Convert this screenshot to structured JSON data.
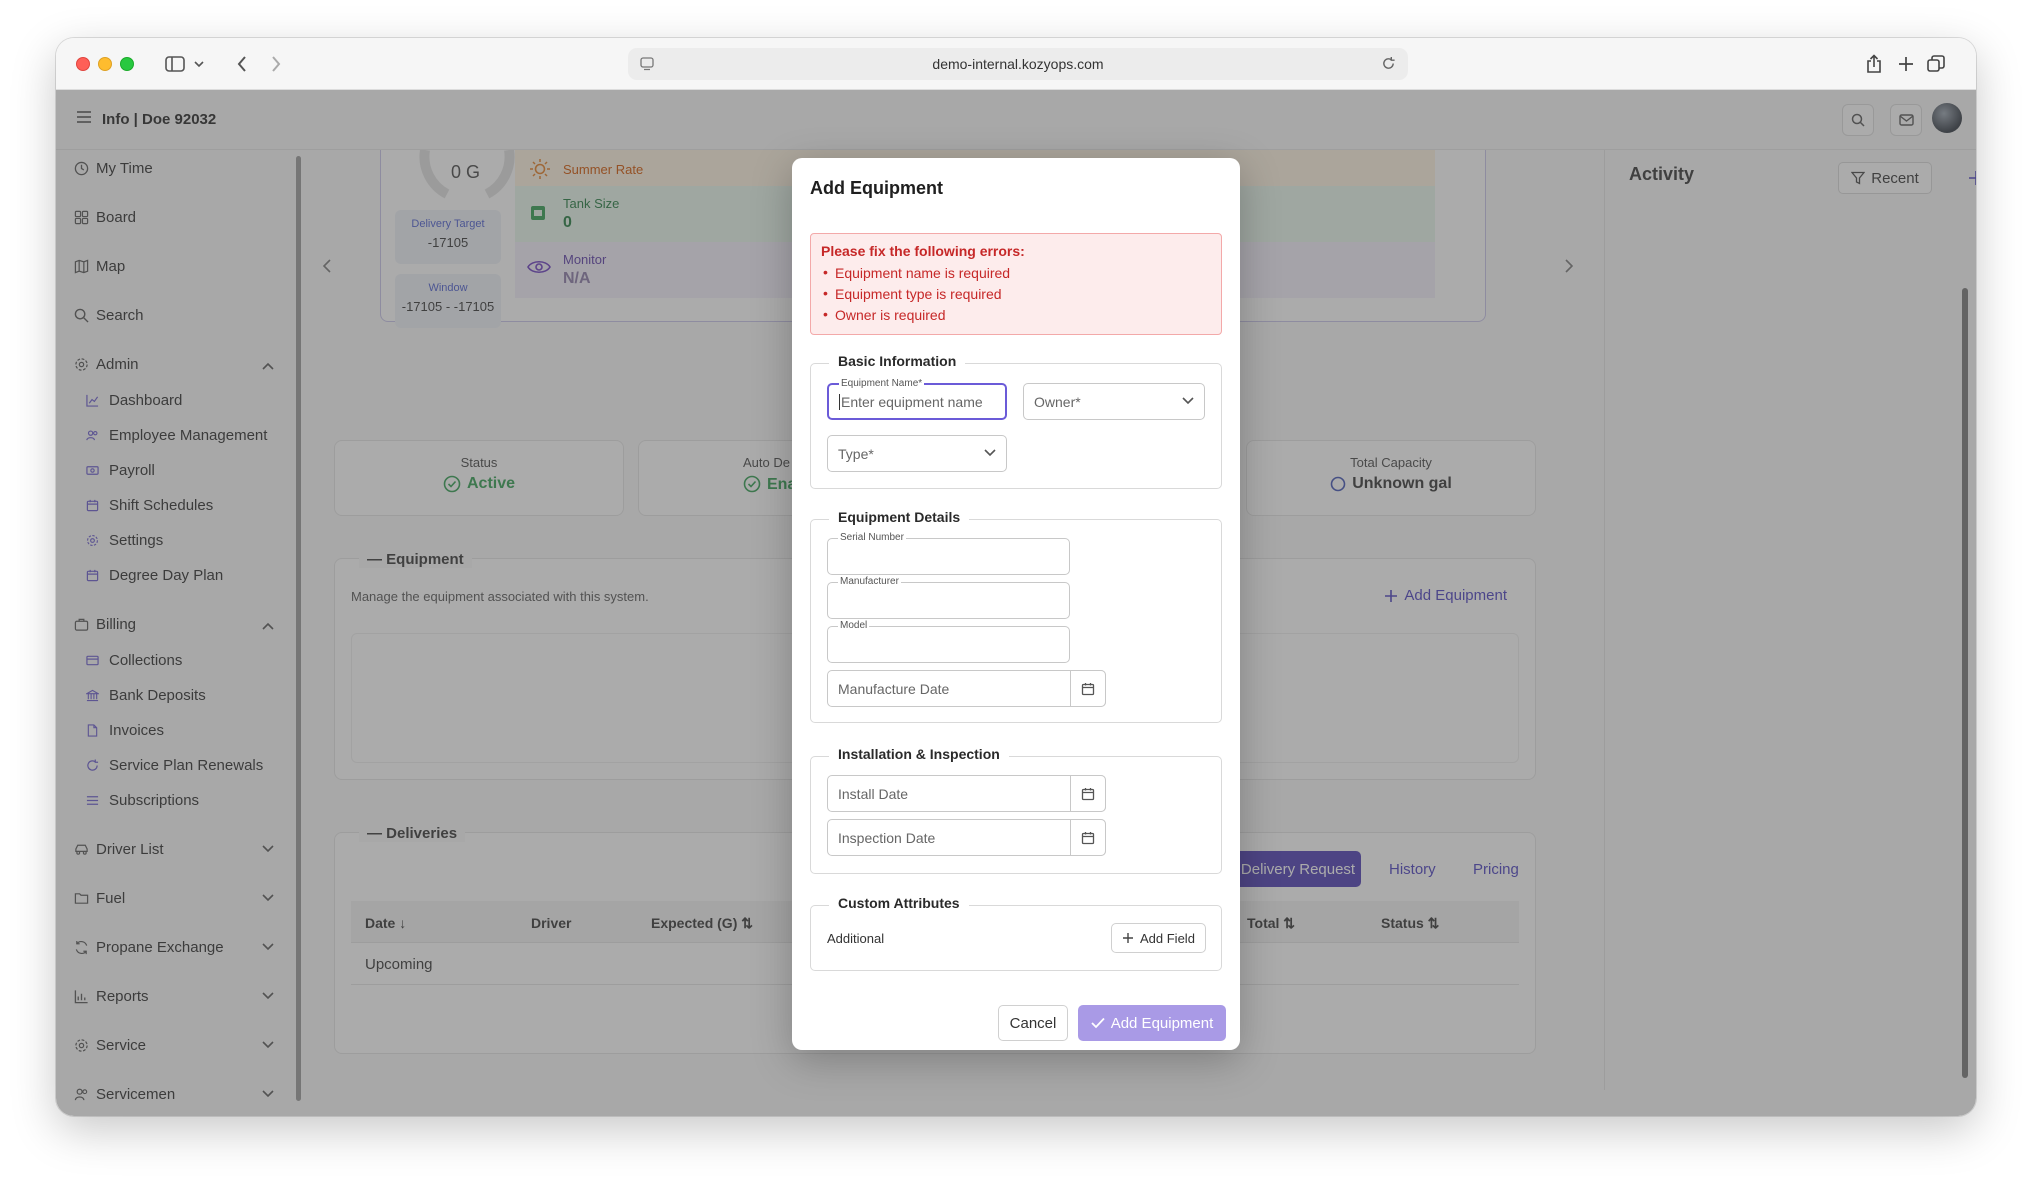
{
  "browser": {
    "url": "demo-internal.kozyops.com"
  },
  "app": {
    "title": "Info | Doe 92032"
  },
  "sidebar": {
    "items": [
      {
        "label": "My Time",
        "icon": "clock-icon"
      },
      {
        "label": "Board",
        "icon": "grid-icon"
      },
      {
        "label": "Map",
        "icon": "map-icon"
      },
      {
        "label": "Search",
        "icon": "search-icon"
      },
      {
        "label": "Admin",
        "icon": "gear-icon"
      },
      {
        "label": "Dashboard",
        "icon": "chart-icon"
      },
      {
        "label": "Employee Management",
        "icon": "users-icon"
      },
      {
        "label": "Payroll",
        "icon": "money-icon"
      },
      {
        "label": "Shift Schedules",
        "icon": "calendar-icon"
      },
      {
        "label": "Settings",
        "icon": "gear-icon"
      },
      {
        "label": "Degree Day Plan",
        "icon": "calendar-icon"
      },
      {
        "label": "Billing",
        "icon": "briefcase-icon"
      },
      {
        "label": "Collections",
        "icon": "card-icon"
      },
      {
        "label": "Bank Deposits",
        "icon": "bank-icon"
      },
      {
        "label": "Invoices",
        "icon": "file-icon"
      },
      {
        "label": "Service Plan Renewals",
        "icon": "refresh-icon"
      },
      {
        "label": "Subscriptions",
        "icon": "list-icon"
      },
      {
        "label": "Driver List",
        "icon": "car-icon"
      },
      {
        "label": "Fuel",
        "icon": "folder-icon"
      },
      {
        "label": "Propane Exchange",
        "icon": "exchange-icon"
      },
      {
        "label": "Reports",
        "icon": "chart-icon"
      },
      {
        "label": "Service",
        "icon": "gear-icon"
      },
      {
        "label": "Servicemen",
        "icon": "users-icon"
      }
    ]
  },
  "background": {
    "gauge_value": "0 G",
    "delivery_target_label": "Delivery Target",
    "delivery_target_value": "-17105",
    "window_label": "Window",
    "window_value": "-17105 - -17105",
    "summer_rate_label": "Summer Rate",
    "tank_size_label": "Tank Size",
    "tank_size_value": "0",
    "monitor_label": "Monitor",
    "monitor_value": "N/A",
    "status_label": "Status",
    "status_value": "Active",
    "auto_label": "Auto De",
    "auto_value": "Ena",
    "total_capacity_label": "Total Capacity",
    "total_capacity_value": "Unknown gal",
    "equipment_title": "Equipment",
    "equipment_desc": "Manage the equipment associated with this system.",
    "add_equipment_link": "Add Equipment",
    "deliveries_title": "Deliveries",
    "delivery_request_btn": "Delivery Request",
    "history_tab": "History",
    "pricing_tab": "Pricing",
    "columns": [
      "Date",
      "Driver",
      "Expected (G)",
      "Total",
      "Status"
    ],
    "upcoming_row": "Upcoming",
    "activity_title": "Activity",
    "recent_btn": "Recent"
  },
  "modal": {
    "title": "Add Equipment",
    "error_title": "Please fix the following errors:",
    "errors": [
      "Equipment name is required",
      "Equipment type is required",
      "Owner is required"
    ],
    "basic_info": {
      "legend": "Basic Information",
      "name_label": "Equipment Name*",
      "name_placeholder": "Enter equipment name",
      "owner_placeholder": "Owner*",
      "type_placeholder": "Type*"
    },
    "details": {
      "legend": "Equipment Details",
      "serial_label": "Serial Number",
      "manufacturer_label": "Manufacturer",
      "model_label": "Model",
      "manufacture_date_placeholder": "Manufacture Date"
    },
    "installation": {
      "legend": "Installation & Inspection",
      "install_date_placeholder": "Install Date",
      "inspection_date_placeholder": "Inspection Date"
    },
    "custom": {
      "legend": "Custom Attributes",
      "additional_label": "Additional",
      "add_field_btn": "Add Field"
    },
    "cancel_btn": "Cancel",
    "submit_btn": "Add Equipment"
  },
  "colors": {
    "accent": "#5b47c9",
    "primary_disabled": "#a99ae6",
    "error_text": "#c62828",
    "error_bg": "#fdecec",
    "active_green": "#2e9d4f"
  }
}
